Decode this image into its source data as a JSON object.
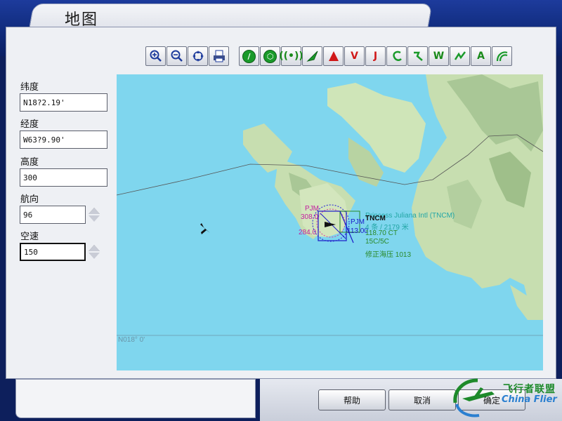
{
  "window": {
    "title": "地图"
  },
  "toolbar": {
    "view_buttons": [
      {
        "icon": "zoom-in-icon"
      },
      {
        "icon": "zoom-out-icon"
      },
      {
        "icon": "center-aircraft-icon"
      },
      {
        "icon": "print-icon"
      }
    ],
    "filter_buttons": [
      {
        "icon": "airport-icon",
        "label": ""
      },
      {
        "icon": "vor-icon",
        "label": ""
      },
      {
        "icon": "ndb-icon",
        "label": ""
      },
      {
        "icon": "ils-icon",
        "label": ""
      },
      {
        "icon": "waypoint-icon",
        "label": ""
      },
      {
        "icon": "victor-airway-icon",
        "label": "V"
      },
      {
        "icon": "jet-airway-icon",
        "label": "J"
      },
      {
        "icon": "terrain-icon",
        "label": ""
      },
      {
        "icon": "route-icon",
        "label": ""
      },
      {
        "icon": "weather-icon",
        "label": "W"
      },
      {
        "icon": "flight-plan-icon",
        "label": ""
      },
      {
        "icon": "airspace-icon",
        "label": "A"
      },
      {
        "icon": "traffic-icon",
        "label": ""
      }
    ]
  },
  "fields": {
    "latitude": {
      "label": "纬度",
      "value": "N18?2.19'"
    },
    "longitude": {
      "label": "经度",
      "value": "W63?9.90'"
    },
    "altitude": {
      "label": "高度",
      "value": "300"
    },
    "heading": {
      "label": "航向",
      "value": "96"
    },
    "airspeed": {
      "label": "空速",
      "value": "150"
    }
  },
  "map": {
    "colors": {
      "water": "#7fd6ee",
      "land": "#cbe2b3",
      "land_dark": "#94b985"
    },
    "airport": {
      "name": "Princess Juliana Intl (TNCM)",
      "icao": "TNCM",
      "runway": "4 条 / 2179 米",
      "freq1": "118.70 CT",
      "wind": "15C/5C",
      "pressure": "修正海压 1013"
    },
    "vor": {
      "ident": "PJM",
      "freq": "308.0",
      "radial": "284.0"
    },
    "ndb": {
      "ident": "PJM",
      "freq": "113.00"
    },
    "grid_label": "N018° 0'"
  },
  "buttons": {
    "help": "帮助",
    "cancel": "取消",
    "ok": "确定"
  },
  "watermark": {
    "cn": "飞行者联盟",
    "en": "China Flier"
  }
}
